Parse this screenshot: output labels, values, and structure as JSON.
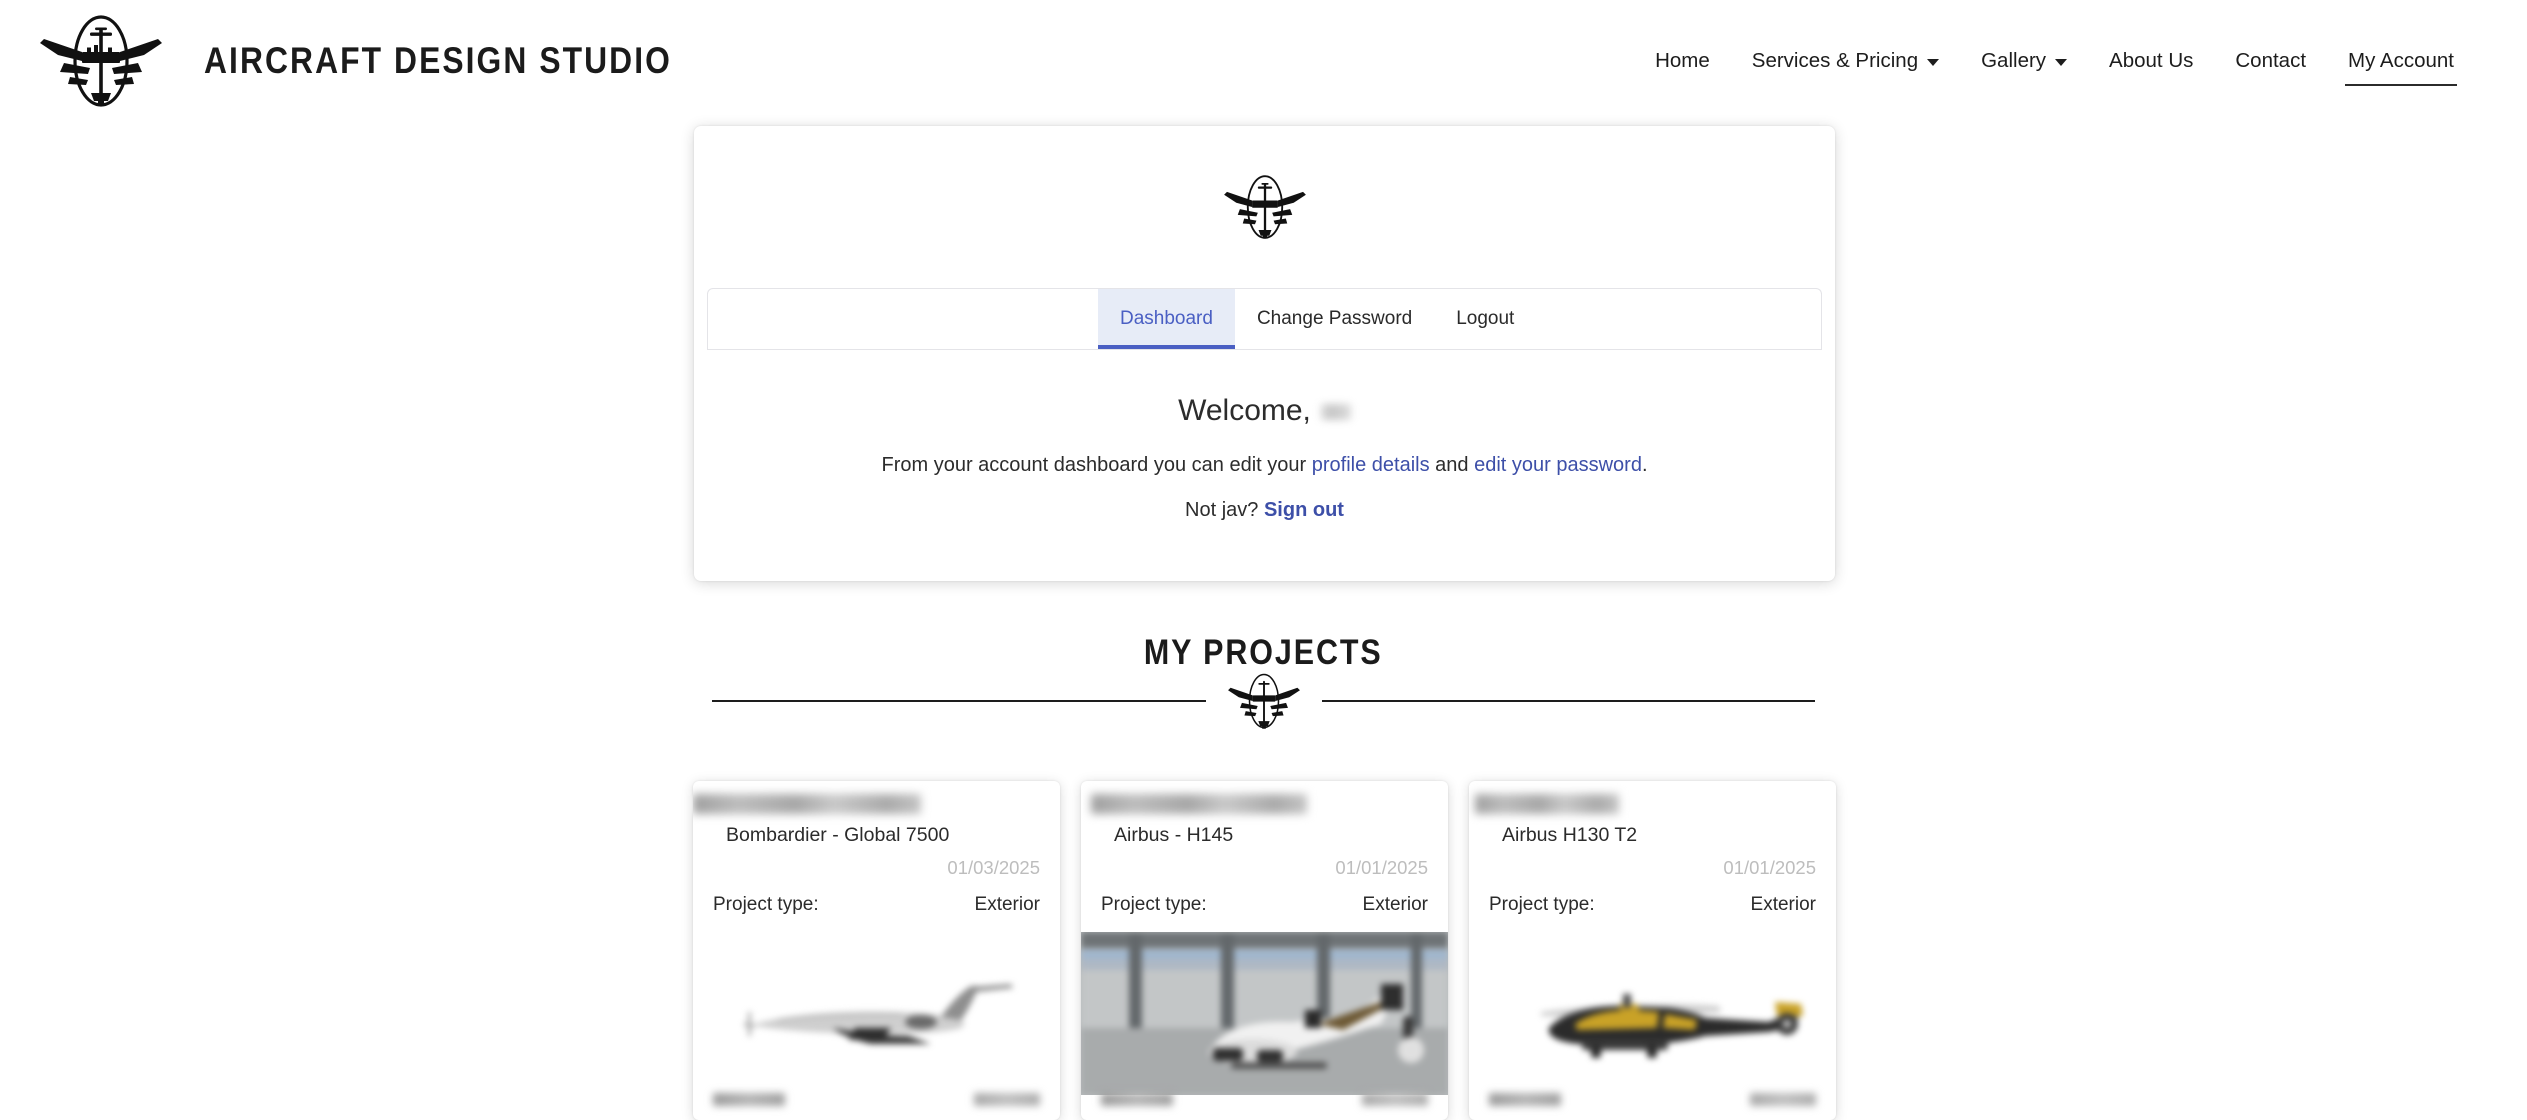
{
  "header": {
    "brand_name": "AIRCRAFT DESIGN STUDIO",
    "logo_icon": "winged-aircraft-logo",
    "nav": [
      {
        "label": "Home",
        "has_dropdown": false,
        "active": false
      },
      {
        "label": "Services & Pricing",
        "has_dropdown": true,
        "active": false
      },
      {
        "label": "Gallery",
        "has_dropdown": true,
        "active": false
      },
      {
        "label": "About Us",
        "has_dropdown": false,
        "active": false
      },
      {
        "label": "Contact",
        "has_dropdown": false,
        "active": false
      },
      {
        "label": "My Account",
        "has_dropdown": false,
        "active": true
      }
    ]
  },
  "account_card": {
    "logo_icon": "winged-aircraft-logo",
    "tabs": [
      {
        "label": "Dashboard",
        "active": true
      },
      {
        "label": "Change Password",
        "active": false
      },
      {
        "label": "Logout",
        "active": false
      }
    ],
    "welcome_prefix": "Welcome,",
    "welcome_username": "",
    "description_before": "From your account dashboard you can edit your",
    "description_link_1": "profile details",
    "description_middle": "and",
    "description_link_2": "edit your password",
    "description_end": ".",
    "signout_prefix": "Not jav?",
    "signout_link": "Sign out"
  },
  "projects_section": {
    "heading": "MY PROJECTS",
    "divider_logo_icon": "winged-aircraft-logo",
    "cards": [
      {
        "title_redacted": true,
        "model": "Bombardier - Global 7500",
        "date": "01/03/2025",
        "type_label": "Project type:",
        "type_value": "Exterior",
        "thumbnail": "business-jet-side-view",
        "thumbnail_style": "plain",
        "footer_label_redacted": true,
        "footer_value_redacted": true
      },
      {
        "title_redacted": true,
        "model": "Airbus - H145",
        "date": "01/01/2025",
        "type_label": "Project type:",
        "type_value": "Exterior",
        "thumbnail": "helicopter-in-hangar",
        "thumbnail_style": "hangar",
        "footer_label_redacted": true,
        "footer_value_redacted": true
      },
      {
        "title_redacted": true,
        "model": "Airbus H130 T2",
        "date": "01/01/2025",
        "type_label": "Project type:",
        "type_value": "Exterior",
        "thumbnail": "black-yellow-helicopter",
        "thumbnail_style": "plain",
        "footer_label_redacted": true,
        "footer_value_redacted": true
      }
    ]
  },
  "colors": {
    "accent_blue": "#4a5fc3",
    "link_blue": "#3d4fa8",
    "active_tab_bg": "#e7ecf7",
    "muted_gray": "#bdbdbd",
    "text": "#2b2b2b",
    "page_bg": "#ffffff"
  }
}
